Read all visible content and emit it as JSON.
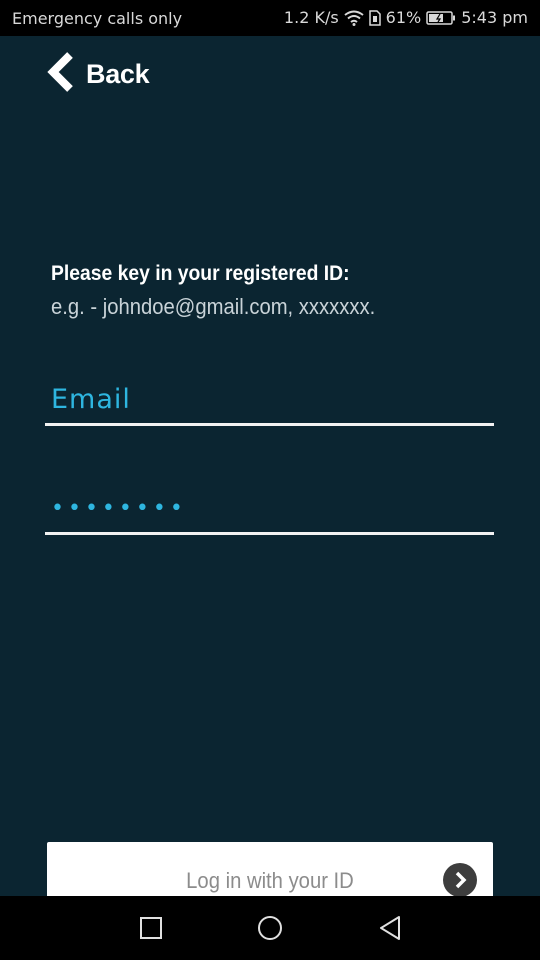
{
  "status_bar": {
    "carrier_text": "Emergency calls only",
    "network_speed": "1.2 K/s",
    "battery_percent": "61%",
    "time": "5:43 pm",
    "icons": [
      "wifi-icon",
      "sim-icon",
      "battery-icon"
    ]
  },
  "header": {
    "back_label": "Back",
    "back_icon": "chevron-left-icon"
  },
  "instructions": {
    "title": "Please key in your registered ID:",
    "example": "e.g. - johndoe@gmail.com, xxxxxxx."
  },
  "form": {
    "email_placeholder": "Email",
    "email_value": "",
    "password_value": "••••••••"
  },
  "login_button": {
    "label": "Log in with your ID",
    "icon": "arrow-right-circle-icon"
  },
  "nav_bar": {
    "icons": [
      "recents-square-icon",
      "home-circle-icon",
      "back-triangle-icon"
    ]
  },
  "colors": {
    "background": "#0b2531",
    "accent": "#2eb6e0",
    "status_bar": "#000000"
  }
}
